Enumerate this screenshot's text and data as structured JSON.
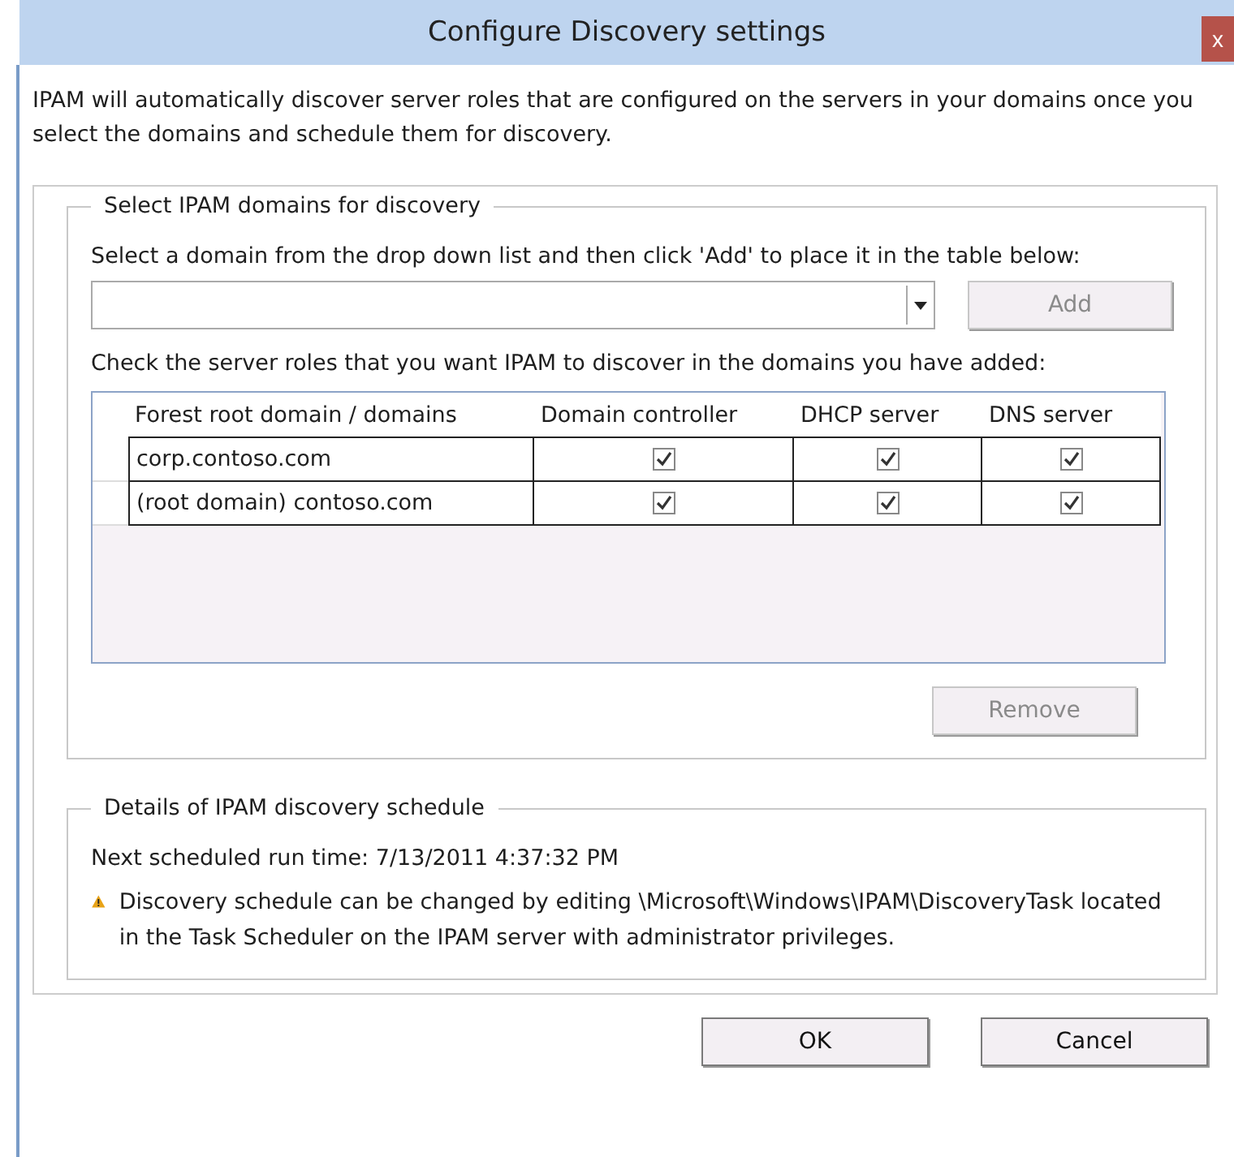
{
  "window": {
    "title": "Configure Discovery settings",
    "close": "x"
  },
  "intro": "IPAM will automatically discover server roles that are configured on the servers in your domains once you select the domains and schedule them for discovery.",
  "domains_group": {
    "legend": "Select IPAM domains for discovery",
    "instruction": "Select a domain from the drop down list and then click 'Add' to place it in the table below:",
    "add_button": {
      "label": "Add",
      "disabled": true
    },
    "roles_instruction": "Check the server roles that you want IPAM to discover in the domains you have added:",
    "table": {
      "columns": [
        "Forest root domain / domains",
        "Domain controller",
        "DHCP server",
        "DNS server"
      ],
      "rows": [
        {
          "domain": "corp.contoso.com",
          "roles": [
            {
              "checked": true
            },
            {
              "checked": true
            },
            {
              "checked": true
            }
          ]
        },
        {
          "domain": "(root domain) contoso.com",
          "roles": [
            {
              "checked": true
            },
            {
              "checked": true
            },
            {
              "checked": true
            }
          ]
        }
      ]
    },
    "remove_button": {
      "label": "Remove",
      "disabled": true
    }
  },
  "schedule_group": {
    "legend": "Details of IPAM discovery schedule",
    "next_run": "Next scheduled run time: 7/13/2011 4:37:32 PM",
    "warning": "Discovery schedule can be changed by editing \\Microsoft\\Windows\\IPAM\\DiscoveryTask located in the Task Scheduler on the IPAM server with administrator privileges."
  },
  "buttons": [
    {
      "label": "OK",
      "disabled": false
    },
    {
      "label": "Cancel",
      "disabled": false
    }
  ]
}
